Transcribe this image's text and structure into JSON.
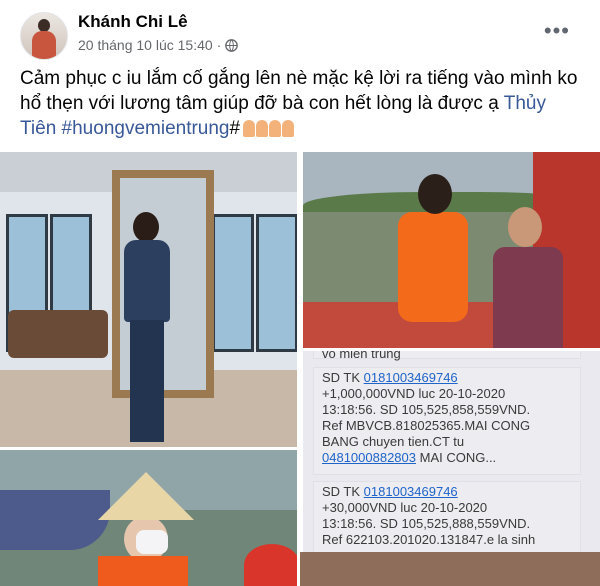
{
  "post": {
    "author": "Khánh Chi Lê",
    "timestamp": "20 tháng 10 lúc 15:40",
    "separator": "·",
    "privacy_icon": "globe-icon",
    "more_icon": "more-options-icon",
    "more_label": "•••",
    "caption_text": "Cảm phục c iu lắm cố gắng lên nè mặc kệ lời ra tiếng vào mình ko hổ thẹn với lương tâm giúp đỡ bà con hết lòng là được ạ ",
    "caption_mention": "Thủy Tiên",
    "caption_hashtag": "#huongvemientrung",
    "caption_hash_suffix": "#",
    "emoji_icon": "folded-hands-icon"
  },
  "messages": {
    "fragment": "vo mien trung",
    "m1": {
      "l1a": "SD TK ",
      "acct": "0181003469746",
      "l2": "+1,000,000VND luc 20-10-2020",
      "l3": "13:18:56. SD 105,525,858,559VND.",
      "l4": "Ref MBVCB.818025365.MAI CONG",
      "l5": "BANG chuyen tien.CT tu",
      "acct2": "0481000882803",
      "l6b": " MAI CONG..."
    },
    "m2": {
      "l1a": "SD TK ",
      "acct": "0181003469746",
      "l2": "+30,000VND luc 20-10-2020",
      "l3": "13:18:56. SD 105,525,888,559VND.",
      "l4": "Ref 622103.201020.131847.e la sinh"
    }
  },
  "colors": {
    "link": "#385898",
    "text": "#050505",
    "meta": "#65676b",
    "sms_link": "#1f64c8"
  }
}
